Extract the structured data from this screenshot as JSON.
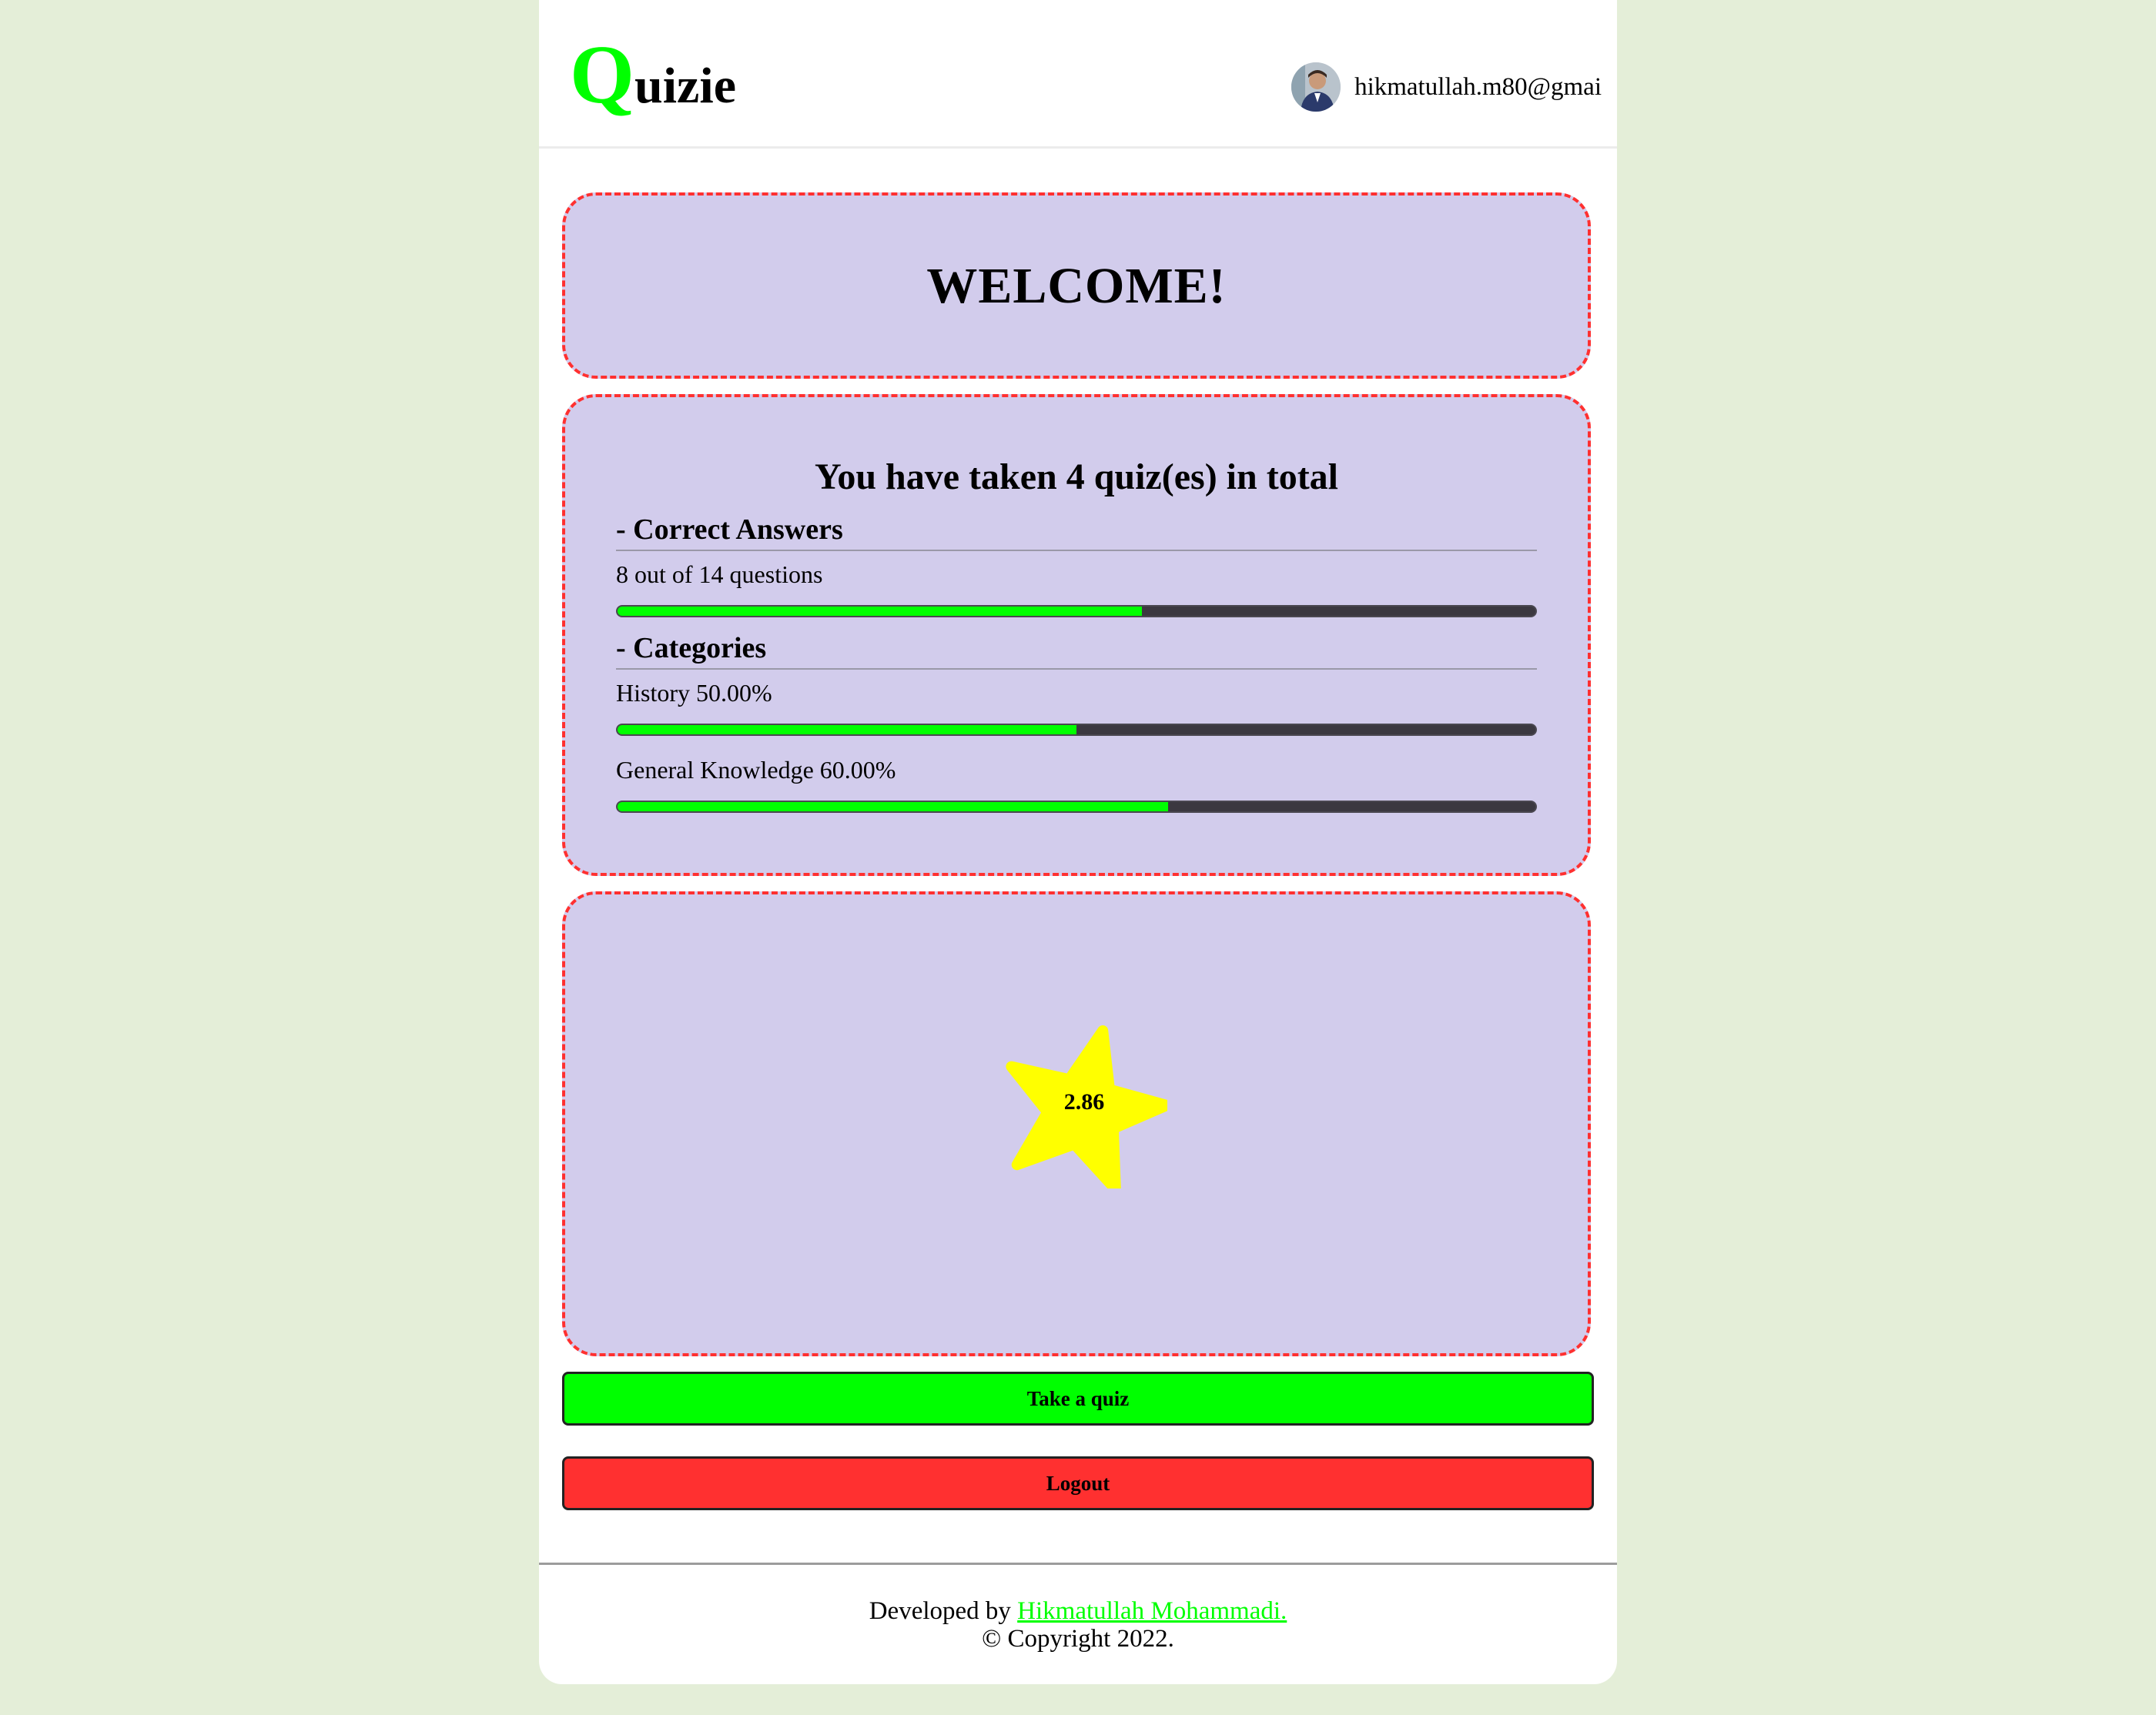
{
  "header": {
    "logo_initial": "Q",
    "logo_rest": "uizie",
    "user_email": "hikmatullah.m80@gmai"
  },
  "welcome": {
    "title": "WELCOME!"
  },
  "stats": {
    "title": "You have taken 4 quiz(es) in total",
    "quiz_count": 4,
    "correct_heading": "- Correct Answers",
    "correct_text": "8 out of 14 questions",
    "correct": 8,
    "total": 14,
    "categories_heading": "- Categories",
    "categories": [
      {
        "label": "History 50.00%",
        "percent": 50
      },
      {
        "label": "General Knowledge 60.00%",
        "percent": 60
      }
    ]
  },
  "rating": {
    "value": "2.86",
    "star_color": "#ffff00"
  },
  "buttons": {
    "take_quiz": "Take a quiz",
    "logout": "Logout"
  },
  "footer": {
    "developed_by": "Developed by ",
    "developer_name": "Hikmatullah Mohammadi.",
    "copyright": "© Copyright 2022."
  },
  "colors": {
    "accent": "#00ff00",
    "danger": "#ff3030",
    "card_bg": "#d2ccec",
    "page_bg": "#e4eed8"
  }
}
